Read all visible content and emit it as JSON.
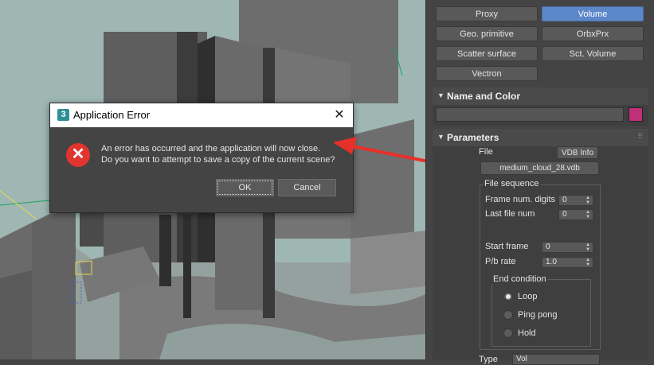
{
  "dialog": {
    "title": "Application Error",
    "app_icon": "3",
    "close_glyph": "✕",
    "message_line1": "An error has occurred and the application will now close.",
    "message_line2": "Do you want to attempt to save a copy of the current scene?",
    "ok_label": "OK",
    "cancel_label": "Cancel",
    "error_glyph": "✕"
  },
  "panel": {
    "buttons": {
      "proxy": "Proxy",
      "volume": "Volume",
      "geo_primitive": "Geo. primitive",
      "orbxprx": "OrbxPrx",
      "scatter_surface": "Scatter surface",
      "sct_volume": "Sct. Volume",
      "vectron": "Vectron"
    },
    "name_color": {
      "header": "Name and Color",
      "swatch_color": "#c0307a"
    },
    "parameters": {
      "header": "Parameters",
      "file_label": "File",
      "vdb_info": "VDB Info",
      "file_name": "medium_cloud_28.vdb",
      "file_sequence_title": "File sequence",
      "frame_num_digits_label": "Frame num. digits",
      "frame_num_digits_value": "0",
      "last_file_num_label": "Last file num",
      "last_file_num_value": "0",
      "start_frame_label": "Start frame",
      "start_frame_value": "0",
      "pb_rate_label": "P/b rate",
      "pb_rate_value": "1.0",
      "end_condition_title": "End condition",
      "loop": "Loop",
      "ping_pong": "Ping pong",
      "hold": "Hold",
      "type_label": "Type",
      "type_value": "Vol"
    },
    "caret": "▼",
    "dots": "⠿"
  },
  "colors": {
    "accent": "#5c87c8",
    "error": "#e0342f",
    "arrow": "#e8302a"
  }
}
